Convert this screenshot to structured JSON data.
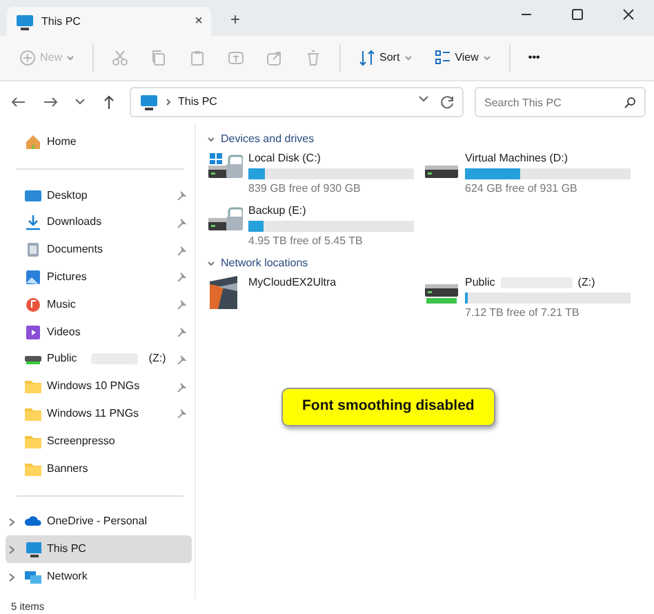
{
  "window": {
    "tab_title": "This PC",
    "close_tab": "×",
    "new_tab": "+"
  },
  "toolbar": [
    {
      "kind": "new",
      "label": "New",
      "disabled": true
    },
    {
      "kind": "cut",
      "disabled": true
    },
    {
      "kind": "copy",
      "disabled": true
    },
    {
      "kind": "paste",
      "disabled": true
    },
    {
      "kind": "rename",
      "disabled": true
    },
    {
      "kind": "share",
      "disabled": true
    },
    {
      "kind": "delete",
      "disabled": true
    },
    {
      "kind": "sort",
      "label": "Sort",
      "disabled": false
    },
    {
      "kind": "view",
      "label": "View",
      "disabled": false
    },
    {
      "kind": "more",
      "label": "•••",
      "disabled": false
    }
  ],
  "address": {
    "path": "This PC",
    "search_placeholder": "Search This PC"
  },
  "sidebar": [
    {
      "kind": "home",
      "label": "Home"
    },
    {
      "kind": "divider"
    },
    {
      "kind": "desktop",
      "label": "Desktop",
      "pinned": true
    },
    {
      "kind": "downloads",
      "label": "Downloads",
      "pinned": true
    },
    {
      "kind": "documents",
      "label": "Documents",
      "pinned": true
    },
    {
      "kind": "pictures",
      "label": "Pictures",
      "pinned": true
    },
    {
      "kind": "music",
      "label": "Music",
      "pinned": true
    },
    {
      "kind": "videos",
      "label": "Videos",
      "pinned": true
    },
    {
      "kind": "netdrive",
      "label": "Public",
      "suffix": "(Z:)",
      "redacted": true,
      "pinned": true
    },
    {
      "kind": "folder",
      "label": "Windows 10 PNGs",
      "pinned": true
    },
    {
      "kind": "folder",
      "label": "Windows 11 PNGs",
      "pinned": true
    },
    {
      "kind": "folder",
      "label": "Screenpresso",
      "pinned": false
    },
    {
      "kind": "folder",
      "label": "Banners",
      "pinned": false
    },
    {
      "kind": "divider"
    },
    {
      "kind": "onedrive",
      "label": "OneDrive - Personal",
      "selected": false
    },
    {
      "kind": "thispc",
      "label": "This PC",
      "selected": true
    },
    {
      "kind": "network",
      "label": "Network",
      "selected": false
    }
  ],
  "sections": [
    {
      "title": "Devices and drives",
      "items": [
        {
          "kind": "windisk",
          "name": "Local Disk (C:)",
          "level": 0.1,
          "free": "839 GB free of 930 GB"
        },
        {
          "kind": "disk",
          "name": "Virtual Machines (D:)",
          "level": 0.33,
          "free": "624 GB free of 931 GB"
        },
        {
          "kind": "lockdisk",
          "name": "Backup (E:)",
          "level": 0.09,
          "free": "4.95 TB free of 5.45 TB"
        }
      ]
    },
    {
      "title": "Network locations",
      "items": [
        {
          "kind": "nas",
          "name": "MyCloudEX2Ultra"
        },
        {
          "kind": "netdisk",
          "name": "Public",
          "suffix": "(Z:)",
          "redacted": true,
          "level": 0.02,
          "free": "7.12 TB free of 7.21 TB"
        }
      ]
    }
  ],
  "note": "Font smoothing disabled",
  "status_bar": "5 items"
}
